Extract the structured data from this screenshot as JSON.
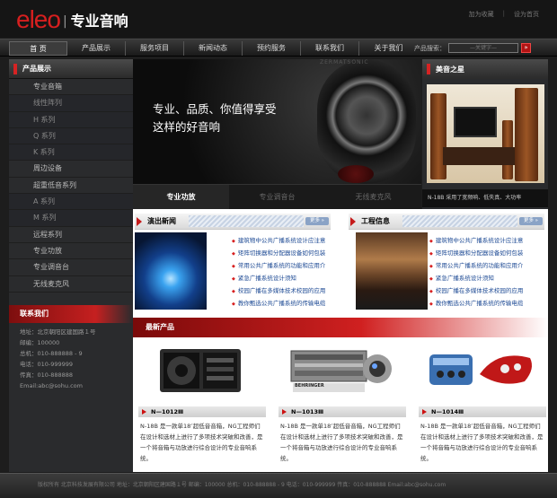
{
  "header": {
    "logo_en": "eleo",
    "logo_sep": "|",
    "logo_cn": "专业音响",
    "links": [
      "加为收藏",
      "设为首页"
    ],
    "link_sep": "|"
  },
  "nav": {
    "items": [
      "首 页",
      "产品展示",
      "服务项目",
      "新闻动态",
      "预约服务",
      "联系我们",
      "关于我们"
    ],
    "search_label": "产品搜索：",
    "search_placeholder": "—关键字—",
    "search_button": "»"
  },
  "sidebar": {
    "title": "产品展示",
    "items": [
      "专业音箱",
      "线性阵列",
      "H 系列",
      "Q 系列",
      "K 系列",
      "周边设备",
      "超重低音系列",
      "A 系列",
      "M 系列",
      "远程系列",
      "专业功放",
      "专业调音台",
      "无线麦克风"
    ],
    "contact_title": "联系我们",
    "contact_lines": [
      "地址：北京朝阳区建国路１号",
      "邮编：100000",
      "总机：010-888888 - 9",
      "电话：010-999999",
      "传真：010-888888",
      "Email:abc@sohu.com"
    ]
  },
  "hero": {
    "brand": "ZERMATSONIC",
    "line1": "专业、品质、你值得享受",
    "line2": "这样的好音响",
    "tabs": [
      "专业功放",
      "专业调音台",
      "无线麦克风"
    ]
  },
  "star": {
    "title": "美音之星",
    "caption": "N-18B 采用了宽频响、低失真、大功率"
  },
  "news": {
    "title": "演出新闻",
    "more": "更多 »",
    "items": [
      "建筑物中公共广播系统设计应注意",
      "矩阵切换器和分配器设备如何包装",
      "常用公共广播系统的功能和应用介",
      "紧急广播系统设计须知",
      "校园广播在多媒体技术校园的应用",
      "教你甄选公共广播系统的传输电缆"
    ]
  },
  "project": {
    "title": "工程信息",
    "more": "更多 »",
    "items": [
      "建筑物中公共广播系统设计应注意",
      "矩阵切换器和分配器设备如何包装",
      "常用公共广播系统的功能和应用介",
      "紧急广播系统设计须知",
      "校园广播在多媒体技术校园的应用",
      "教你甄选公共广播系统的传输电缆"
    ]
  },
  "products": {
    "title": "最新产品",
    "items": [
      {
        "name": "N—1012Ⅲ",
        "desc": "N-18B 是一款单18″超低音音箱，NG工程师们在设计和选材上进行了多项技术突破和改善，是一个将音箱与功放进行综合设计的专业音响系统。"
      },
      {
        "name": "N—1013Ⅲ",
        "brand": "BEHRINGER",
        "desc": "N-18B 是一款单18″超低音音箱，NG工程师们在设计和选材上进行了多项技术突破和改善，是一个将音箱与功放进行综合设计的专业音响系统。"
      },
      {
        "name": "N—1014Ⅲ",
        "desc": "N-18B 是一款单18″超低音音箱，NG工程师们在设计和选材上进行了多项技术突破和改善，是一个将音箱与功放进行综合设计的专业音响系统。"
      }
    ]
  },
  "footer": {
    "text": "版权所有  北京科技发展有限公司 地址：北京朝阳区建国路１号 邮编：100000  总机：010-888888 - 9 电话：010-999999 传真：010-888888 Email:abc@sohu.com"
  },
  "colors": {
    "accent_red": "#d61f1f",
    "link_blue": "#1d4a94",
    "background": "#1d1d1d"
  }
}
